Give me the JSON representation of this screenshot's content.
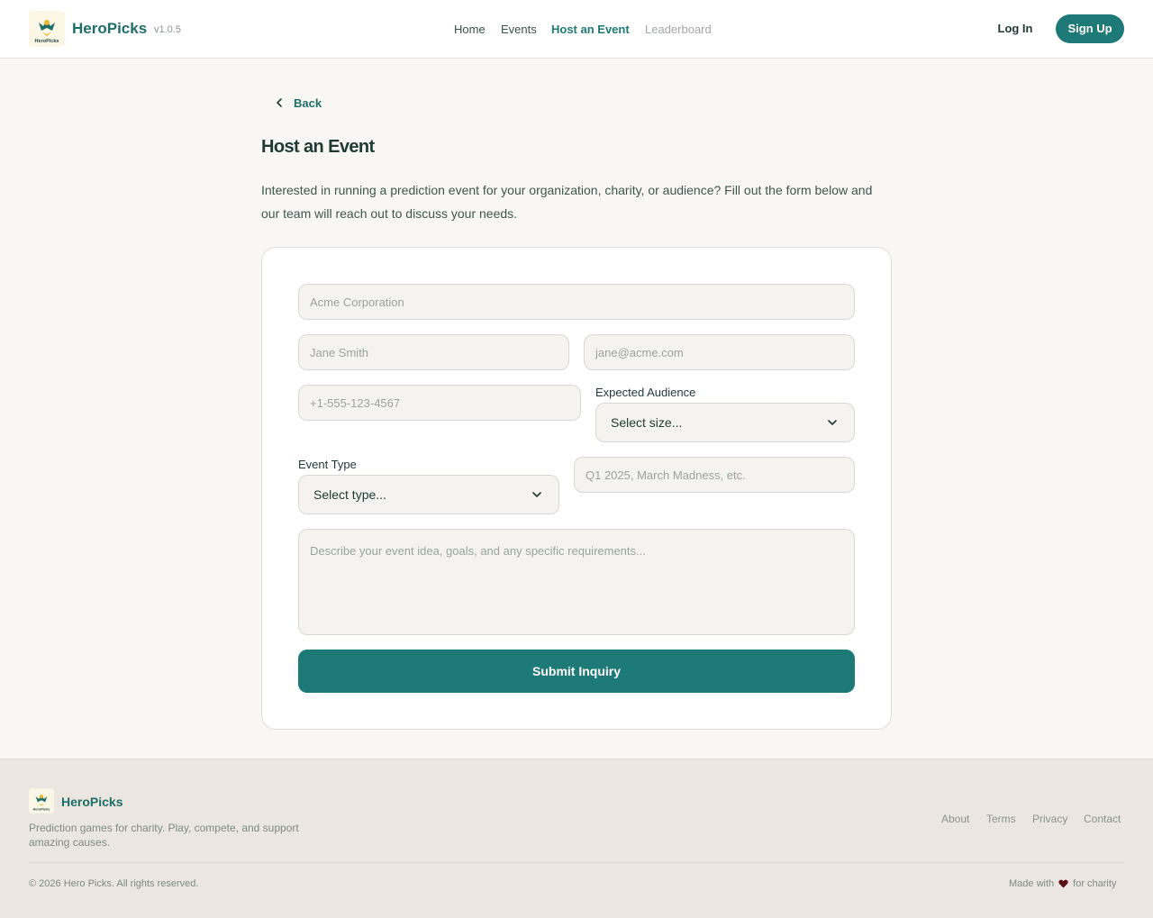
{
  "header": {
    "brand": "HeroPicks",
    "logo_text": "HeroPicks",
    "version": "v1.0.5",
    "nav": [
      {
        "label": "Home"
      },
      {
        "label": "Events"
      },
      {
        "label": "Host an Event"
      },
      {
        "label": "Leaderboard"
      }
    ],
    "login": "Log In",
    "signup": "Sign Up"
  },
  "page": {
    "back": "Back",
    "title": "Host an Event",
    "intro": "Interested in running a prediction event for your organization, charity, or audience? Fill out the form below and our team will reach out to discuss your needs."
  },
  "form": {
    "organization_placeholder": "Acme Corporation",
    "name_placeholder": "Jane Smith",
    "email_placeholder": "jane@acme.com",
    "phone_placeholder": "+1-555-123-4567",
    "audience_label": "Expected Audience",
    "audience_value": "Select size...",
    "event_type_label": "Event Type",
    "event_type_value": "Select type...",
    "timeframe_placeholder": "Q1 2025, March Madness, etc.",
    "details_placeholder": "Describe your event idea, goals, and any specific requirements...",
    "submit": "Submit Inquiry"
  },
  "footer": {
    "brand": "HeroPicks",
    "tagline": "Prediction games for charity. Play, compete, and support amazing causes.",
    "links": [
      {
        "label": "About"
      },
      {
        "label": "Terms"
      },
      {
        "label": "Privacy"
      },
      {
        "label": "Contact"
      }
    ],
    "copyright": "© 2026 Hero Picks. All rights reserved.",
    "made_prefix": "Made with",
    "made_suffix": "for charity"
  },
  "colors": {
    "accent": "#1d7a77",
    "background": "#f8f7f4",
    "footer_bg": "#ebe6e0",
    "heart": "#5a0d12"
  }
}
